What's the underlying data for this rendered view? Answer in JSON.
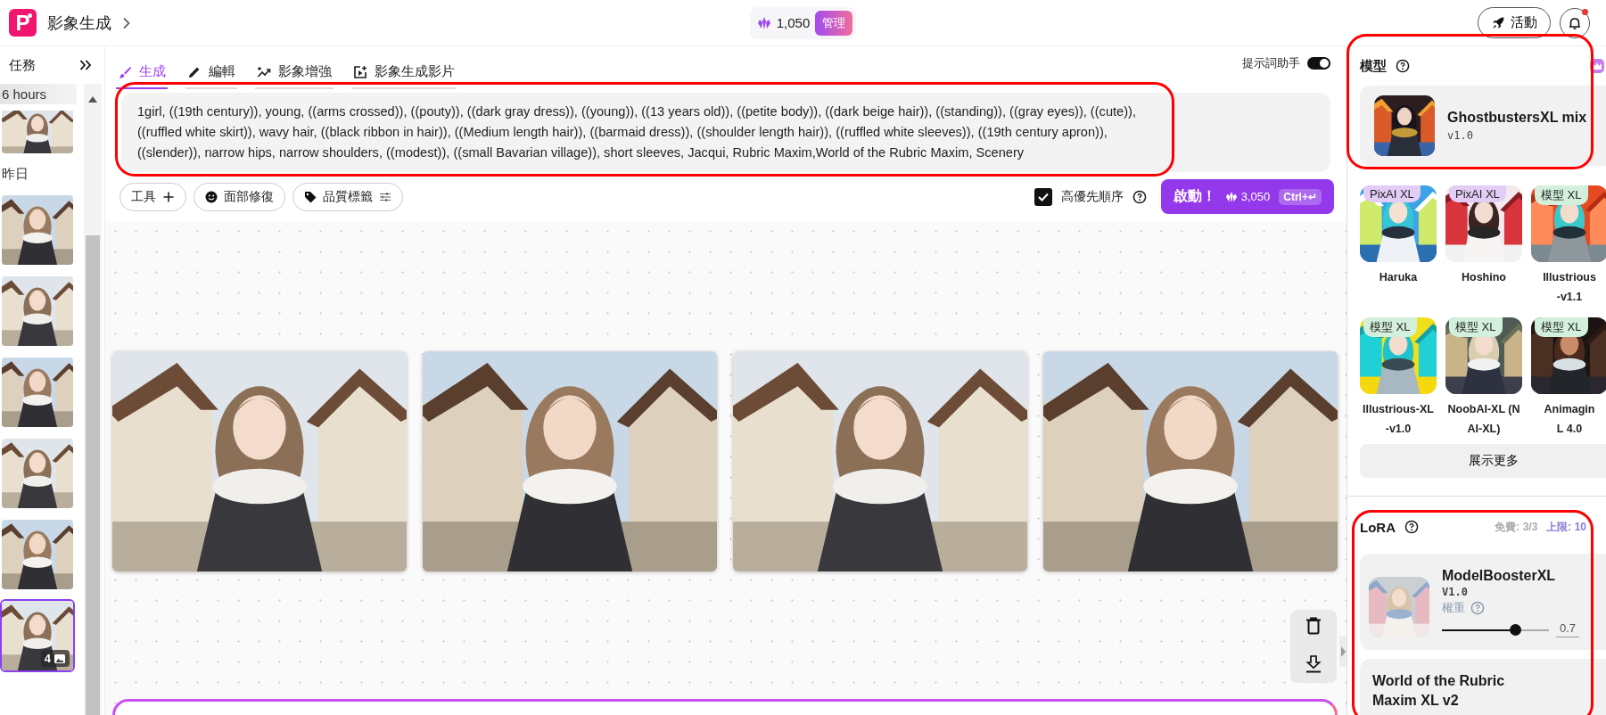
{
  "app": {
    "logo_text": "P",
    "title": "影象生成"
  },
  "credits": {
    "amount": "1,050",
    "manage_label": "管理"
  },
  "header_actions": {
    "event_label": "活動",
    "notification_unread": true
  },
  "sidebar": {
    "title": "任務",
    "groups": [
      {
        "label": "6 hours",
        "items": [
          {
            "selected": false
          }
        ]
      },
      {
        "label": "昨日",
        "items": [
          {
            "selected": false
          },
          {
            "selected": false
          },
          {
            "selected": false
          },
          {
            "selected": false
          },
          {
            "selected": false
          },
          {
            "selected": true,
            "count": "4"
          }
        ]
      }
    ]
  },
  "tabs": [
    {
      "label": "生成",
      "kind": "brush",
      "selected": true
    },
    {
      "label": "編輯",
      "kind": "pencil",
      "selected": false
    },
    {
      "label": "影象增強",
      "kind": "enhance",
      "selected": false
    },
    {
      "label": "影象生成影片",
      "kind": "video",
      "selected": false
    }
  ],
  "assistant_toggle": {
    "label": "提示詞助手",
    "on": true
  },
  "prompt": {
    "value": "1girl, ((19th century)), young, ((arms crossed)), ((pouty)), ((dark gray dress)), ((young)), ((13 years old)), ((petite body)), ((dark beige hair)), ((standing)), ((gray eyes)), ((cute)), ((ruffled white skirt)), wavy hair, ((black ribbon in hair)), ((Medium length hair)), ((barmaid dress)), ((shoulder length hair)), ((ruffled white sleeves)), ((19th century apron)), ((slender)), narrow hips, narrow shoulders, ((modest)), ((small Bavarian village)), short sleeves, Jacqui, Rubric Maxim,World of the Rubric Maxim, Scenery"
  },
  "tools": [
    {
      "label": "工具",
      "kind": "add"
    },
    {
      "label": "面部修復",
      "kind": "face"
    },
    {
      "label": "品質標籤",
      "kind": "tag"
    }
  ],
  "priority": {
    "label": "高優先順序",
    "checked": true
  },
  "run_button": {
    "label": "啟動！",
    "cost": "3,050",
    "shortcut": "Ctrl+↵"
  },
  "model_panel": {
    "title": "模型",
    "current": {
      "name": "GhostbustersXL mix",
      "version": "v1.0"
    },
    "options": [
      {
        "badge": "PixAI XL",
        "color": "#e3cdf6",
        "label_lines": [
          "Haruka"
        ]
      },
      {
        "badge": "PixAI XL",
        "color": "#e3cdf6",
        "label_lines": [
          "Hoshino"
        ]
      },
      {
        "badge": "模型 XL",
        "color": "#d3f0dc",
        "label_lines": [
          "Illustrious",
          "-v1.1"
        ]
      },
      {
        "badge": "模型 XL",
        "color": "#d3f0dc",
        "label_lines": [
          "Illustrious-XL",
          "-v1.0"
        ]
      },
      {
        "badge": "模型 XL",
        "color": "#d3f0dc",
        "label_lines": [
          "NoobAI-XL (N",
          "AI-XL)"
        ]
      },
      {
        "badge": "模型 XL",
        "color": "#d3f0dc",
        "label_lines": [
          "Animagin",
          "L 4.0"
        ]
      }
    ],
    "show_more": "展示更多"
  },
  "lora": {
    "title": "LoRA",
    "free": "免費: 3/3",
    "limit": "上限: 10",
    "items": [
      {
        "name": "ModelBoosterXL",
        "version": "V1.0",
        "weight_label": "權重",
        "level": 0.68,
        "value": "0.7"
      },
      {
        "name": "World of the Rubric Maxim XL v2"
      }
    ]
  }
}
